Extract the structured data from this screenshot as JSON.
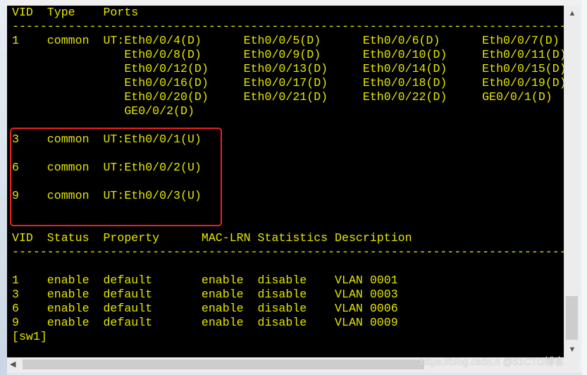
{
  "terminal": {
    "lines": [
      "VID  Type    Ports",
      "-------------------------------------------------------------------------------",
      "1    common  UT:Eth0/0/4(D)      Eth0/0/5(D)      Eth0/0/6(D)      Eth0/0/7(D)",
      "                Eth0/0/8(D)      Eth0/0/9(D)      Eth0/0/10(D)     Eth0/0/11(D)",
      "                Eth0/0/12(D)     Eth0/0/13(D)     Eth0/0/14(D)     Eth0/0/15(D)",
      "                Eth0/0/16(D)     Eth0/0/17(D)     Eth0/0/18(D)     Eth0/0/19(D)",
      "                Eth0/0/20(D)     Eth0/0/21(D)     Eth0/0/22(D)     GE0/0/1(D)",
      "                GE0/0/2(D)",
      "",
      "3    common  UT:Eth0/0/1(U)",
      "",
      "6    common  UT:Eth0/0/2(U)",
      "",
      "9    common  UT:Eth0/0/3(U)",
      "",
      "",
      "VID  Status  Property      MAC-LRN Statistics Description",
      "-------------------------------------------------------------------------------",
      "",
      "1    enable  default       enable  disable    VLAN 0001",
      "3    enable  default       enable  disable    VLAN 0003",
      "6    enable  default       enable  disable    VLAN 0006",
      "9    enable  default       enable  disable    VLAN 0009",
      "[sw1]"
    ],
    "text_color": "#e6e600",
    "background": "#000000",
    "highlight_color": "#e8231f"
  },
  "watermark": "https://blog.csdn.n @51CTO博客",
  "icons": {
    "scroll_up": "chevron-up-icon",
    "scroll_down": "chevron-down-icon",
    "scroll_left": "chevron-left-icon"
  }
}
